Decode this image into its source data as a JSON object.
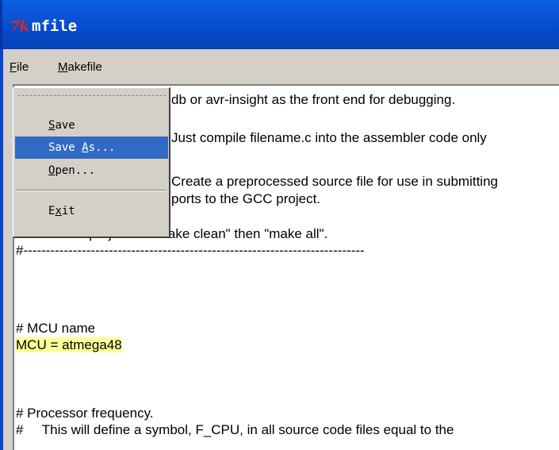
{
  "window": {
    "title": "mfile",
    "icon": "tk-icon"
  },
  "menubar": {
    "file": {
      "label": "File",
      "accel": "F",
      "rest": "ile"
    },
    "makefile": {
      "label": "Makefile",
      "accel": "M",
      "rest": "akefile"
    }
  },
  "file_menu": {
    "tearoff": "tear-off-line",
    "items": [
      {
        "accel": "S",
        "rest": "ave",
        "label": "Save"
      },
      {
        "pre": "Save ",
        "accel": "A",
        "rest": "s...",
        "label": "Save As...",
        "active": true
      },
      {
        "accel": "O",
        "rest": "pen...",
        "label": "Open..."
      },
      {
        "pre": "E",
        "accel": "x",
        "rest": "it",
        "label": "Exit"
      }
    ]
  },
  "editor": {
    "lines": [
      "db or avr-insight as the front end for debugging.",
      "",
      "Just compile filename.c into the assembler code only",
      "",
      "Create a preprocessed source file for use in submitting",
      "ports to the GCC project.",
      "#",
      "# To rebuild project do \"make clean\" then \"make all\".",
      "#----------------------------------------------------------------------------",
      "",
      "",
      "",
      "# MCU name",
      "MCU = atmega48",
      "",
      "",
      "",
      "# Processor frequency.",
      "#     This will define a symbol, F_CPU, in all source code files equal to the"
    ]
  },
  "colors": {
    "title_bar": "#0b54d8",
    "selection": "#316ac5",
    "highlight": "#ffff99"
  }
}
